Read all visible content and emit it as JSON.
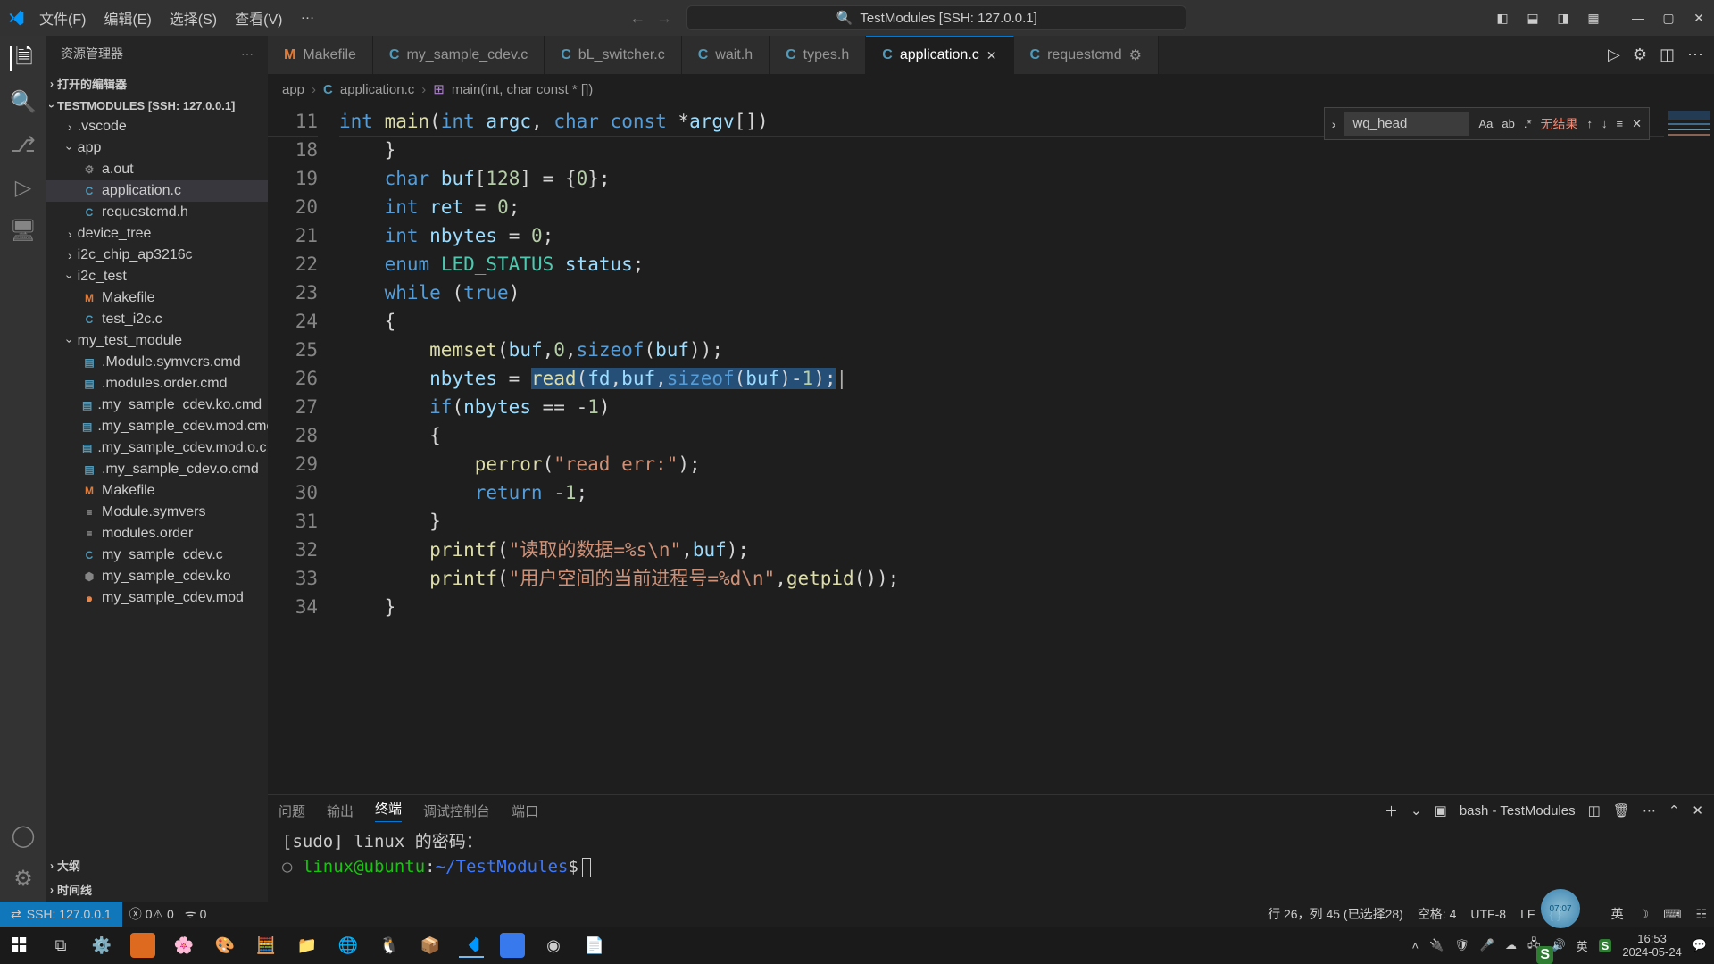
{
  "title_bar": {
    "menu": [
      "文件(F)",
      "编辑(E)",
      "选择(S)",
      "查看(V)",
      "…"
    ],
    "search_text": "TestModules [SSH: 127.0.0.1]"
  },
  "sidebar": {
    "header": "资源管理器",
    "open_editors": "打开的编辑器",
    "workspace": "TESTMODULES [SSH: 127.0.0.1]",
    "tree": [
      {
        "t": "folder",
        "name": ".vscode",
        "collapsed": true,
        "depth": 1
      },
      {
        "t": "folder",
        "name": "app",
        "collapsed": false,
        "depth": 1
      },
      {
        "t": "file",
        "name": "a.out",
        "icon": "gear",
        "depth": 2
      },
      {
        "t": "file",
        "name": "application.c",
        "icon": "C",
        "sel": true,
        "depth": 2
      },
      {
        "t": "file",
        "name": "requestcmd.h",
        "icon": "C",
        "depth": 2
      },
      {
        "t": "folder",
        "name": "device_tree",
        "collapsed": true,
        "depth": 1
      },
      {
        "t": "folder",
        "name": "i2c_chip_ap3216c",
        "collapsed": true,
        "depth": 1
      },
      {
        "t": "folder",
        "name": "i2c_test",
        "collapsed": false,
        "depth": 1
      },
      {
        "t": "file",
        "name": "Makefile",
        "icon": "M",
        "depth": 2
      },
      {
        "t": "file",
        "name": "test_i2c.c",
        "icon": "C",
        "depth": 2
      },
      {
        "t": "folder",
        "name": "my_test_module",
        "collapsed": false,
        "depth": 1
      },
      {
        "t": "file",
        "name": ".Module.symvers.cmd",
        "icon": "cmd",
        "depth": 2
      },
      {
        "t": "file",
        "name": ".modules.order.cmd",
        "icon": "cmd",
        "depth": 2
      },
      {
        "t": "file",
        "name": ".my_sample_cdev.ko.cmd",
        "icon": "cmd",
        "depth": 2
      },
      {
        "t": "file",
        "name": ".my_sample_cdev.mod.cmd",
        "icon": "cmd",
        "depth": 2
      },
      {
        "t": "file",
        "name": ".my_sample_cdev.mod.o.c...",
        "icon": "cmd",
        "depth": 2
      },
      {
        "t": "file",
        "name": ".my_sample_cdev.o.cmd",
        "icon": "cmd",
        "depth": 2
      },
      {
        "t": "file",
        "name": "Makefile",
        "icon": "M",
        "depth": 2
      },
      {
        "t": "file",
        "name": "Module.symvers",
        "icon": "txt",
        "depth": 2
      },
      {
        "t": "file",
        "name": "modules.order",
        "icon": "txt",
        "depth": 2
      },
      {
        "t": "file",
        "name": "my_sample_cdev.c",
        "icon": "C",
        "depth": 2
      },
      {
        "t": "file",
        "name": "my_sample_cdev.ko",
        "icon": "ko",
        "depth": 2
      },
      {
        "t": "file",
        "name": "my_sample_cdev.mod",
        "icon": "mod",
        "depth": 2
      }
    ],
    "outline": "大纲",
    "timeline": "时间线"
  },
  "tabs": [
    {
      "label": "Makefile",
      "icon": "M"
    },
    {
      "label": "my_sample_cdev.c",
      "icon": "C"
    },
    {
      "label": "bL_switcher.c",
      "icon": "C"
    },
    {
      "label": "wait.h",
      "icon": "C"
    },
    {
      "label": "types.h",
      "icon": "C"
    },
    {
      "label": "application.c",
      "icon": "C",
      "active": true,
      "close": true
    },
    {
      "label": "requestcmd",
      "icon": "C",
      "mod": true
    }
  ],
  "breadcrumb": {
    "p1": "app",
    "p2": "application.c",
    "p3": "main(int, char const * [])"
  },
  "find": {
    "value": "wq_head",
    "noresult": "无结果"
  },
  "code_lines": [
    {
      "n": 11,
      "html": "<span class='kw'>int</span> <span class='fn'>main</span><span class='punct'>(</span><span class='kw'>int</span> <span class='var'>argc</span><span class='punct'>,</span> <span class='kw'>char</span> <span class='kw'>const</span> <span class='op'>*</span><span class='var'>argv</span><span class='punct'>[])</span>"
    },
    {
      "n": 18,
      "html": "    <span class='punct'>}</span>"
    },
    {
      "n": 19,
      "html": "    <span class='kw'>char</span> <span class='var'>buf</span><span class='punct'>[</span><span class='num'>128</span><span class='punct'>]</span> <span class='op'>=</span> <span class='punct'>{</span><span class='num'>0</span><span class='punct'>};</span>"
    },
    {
      "n": 20,
      "html": "    <span class='kw'>int</span> <span class='var'>ret</span> <span class='op'>=</span> <span class='num'>0</span><span class='punct'>;</span>"
    },
    {
      "n": 21,
      "html": "    <span class='kw'>int</span> <span class='var'>nbytes</span> <span class='op'>=</span> <span class='num'>0</span><span class='punct'>;</span>"
    },
    {
      "n": 22,
      "html": "    <span class='kw'>enum</span> <span class='ident'>LED_STATUS</span> <span class='var'>status</span><span class='punct'>;</span>"
    },
    {
      "n": 23,
      "html": "    <span class='kw'>while</span> <span class='punct'>(</span><span class='kw'>true</span><span class='punct'>)</span>"
    },
    {
      "n": 24,
      "html": "    <span class='punct'>{</span>"
    },
    {
      "n": 25,
      "html": "        <span class='fn'>memset</span><span class='punct'>(</span><span class='var'>buf</span><span class='punct'>,</span><span class='num'>0</span><span class='punct'>,</span><span class='kw'>sizeof</span><span class='punct'>(</span><span class='var'>buf</span><span class='punct'>));</span>"
    },
    {
      "n": 26,
      "html": "        <span class='var'>nbytes</span> <span class='op'>=</span> <span class='sel'><span class='fn'>read</span><span class='punct'>(</span><span class='var'>fd</span><span class='punct'>,</span><span class='var'>buf</span><span class='punct'>,</span><span class='kw'>sizeof</span><span class='punct'>(</span><span class='var'>buf</span><span class='punct'>)</span><span class='op'>-</span><span class='num'>1</span><span class='punct'>);</span></span><span style='color:#aeafad'>|</span>"
    },
    {
      "n": 27,
      "html": "        <span class='kw'>if</span><span class='punct'>(</span><span class='var'>nbytes</span> <span class='op'>==</span> <span class='op'>-</span><span class='num'>1</span><span class='punct'>)</span>"
    },
    {
      "n": 28,
      "html": "        <span class='punct'>{</span>"
    },
    {
      "n": 29,
      "html": "            <span class='fn'>perror</span><span class='punct'>(</span><span class='str'>\"read err:\"</span><span class='punct'>);</span>"
    },
    {
      "n": 30,
      "html": "            <span class='kw'>return</span> <span class='op'>-</span><span class='num'>1</span><span class='punct'>;</span>"
    },
    {
      "n": 31,
      "html": "        <span class='punct'>}</span>"
    },
    {
      "n": 32,
      "html": "        <span class='fn'>printf</span><span class='punct'>(</span><span class='str'>\"读取的数据=%s\\n\"</span><span class='punct'>,</span><span class='var'>buf</span><span class='punct'>);</span>"
    },
    {
      "n": 33,
      "html": "        <span class='fn'>printf</span><span class='punct'>(</span><span class='str'>\"用户空间的当前进程号=%d\\n\"</span><span class='punct'>,</span><span class='fn'>getpid</span><span class='punct'>());</span>"
    },
    {
      "n": 34,
      "html": "    <span class='punct'>}</span>"
    }
  ],
  "panel": {
    "tabs": [
      "问题",
      "输出",
      "终端",
      "调试控制台",
      "端口"
    ],
    "active": 2,
    "shell": "bash - TestModules",
    "lines": [
      "[sudo] linux 的密码：",
      "linux@ubuntu:~/TestModules$"
    ]
  },
  "status": {
    "remote": "SSH: 127.0.0.1",
    "errors": "0",
    "warnings": "0",
    "ports": "0",
    "ln_col": "行 26，列 45 (已选择28)",
    "spaces": "空格: 4",
    "encoding": "UTF-8",
    "eol": "LF",
    "lang": "{ }"
  },
  "taskbar": {
    "time": "16:53",
    "date": "2024-05-24",
    "ime": "英"
  },
  "overlay_time": "07:07"
}
